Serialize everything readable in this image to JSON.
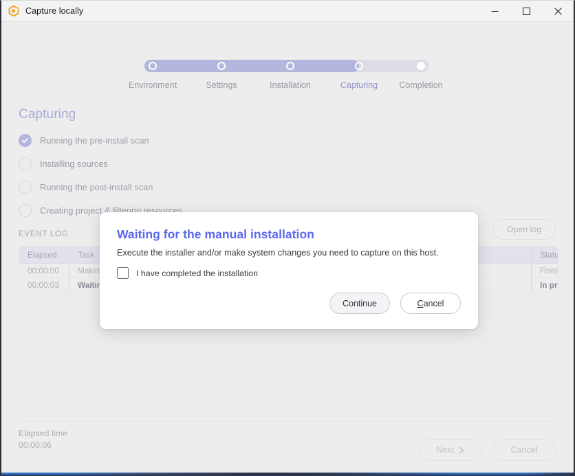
{
  "window": {
    "title": "Capture locally",
    "icon": "app-logo-icon",
    "controls": {
      "minimize": "minimize-icon",
      "maximize": "maximize-icon",
      "close": "close-icon"
    }
  },
  "stepper": {
    "active_index": 3,
    "steps": [
      {
        "label": "Environment",
        "state": "done"
      },
      {
        "label": "Settings",
        "state": "done"
      },
      {
        "label": "Installation",
        "state": "done"
      },
      {
        "label": "Capturing",
        "state": "active"
      },
      {
        "label": "Completion",
        "state": "pending"
      }
    ]
  },
  "main": {
    "heading": "Capturing",
    "tasks": [
      {
        "label": "Running the pre-install scan",
        "state": "complete"
      },
      {
        "label": "Installing sources",
        "state": "incomplete"
      },
      {
        "label": "Running the post-install scan",
        "state": "incomplete"
      },
      {
        "label": "Creating project & filtering resources",
        "state": "incomplete"
      }
    ]
  },
  "event_log": {
    "title": "EVENT LOG",
    "open_log_label": "Open log",
    "columns": [
      "Elapsed",
      "Task",
      "Status"
    ],
    "rows": [
      {
        "elapsed": "00:00:00",
        "task": "Making the pre-install snapshot",
        "status": "Finished",
        "current": false
      },
      {
        "elapsed": "00:00:03",
        "task": "Waiting for the manual installation",
        "status": "In progress",
        "current": true
      }
    ]
  },
  "elapsed": {
    "label": "Elapsed time",
    "value": "00:00:06"
  },
  "footer": {
    "next_label": "Next",
    "next_icon": "chevron-right-icon",
    "cancel_label": "Cancel"
  },
  "dialog": {
    "title": "Waiting for the manual installation",
    "description": "Execute the installer and/or make system changes you need to capture on this host.",
    "checkbox_label": "I have completed the installation",
    "checkbox_checked": false,
    "continue_label": "Continue",
    "cancel_accel": "C",
    "cancel_rest": "ancel"
  },
  "colors": {
    "accent_purple": "#b2b5dd",
    "accent_blue": "#5b68ee",
    "window_bg": "#ededed",
    "track_empty": "#dedde6"
  }
}
